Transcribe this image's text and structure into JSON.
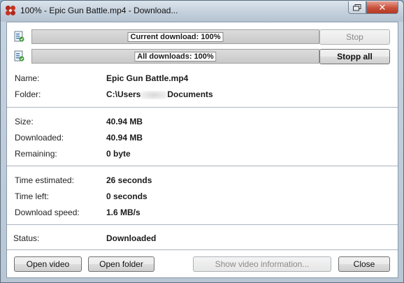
{
  "window": {
    "title": "100% - Epic Gun Battle.mp4 - Download...",
    "app_icon": "app-logo-icon",
    "restore_icon": "restore-window-icon",
    "close_icon": "close-icon"
  },
  "progress": {
    "current": {
      "label": "Current download: 100%",
      "value": 1.0
    },
    "all": {
      "label": "All downloads: 100%",
      "value": 1.0
    },
    "icon": "download-file-icon"
  },
  "buttons": {
    "stop": "Stop",
    "stop_all": "Stopp all",
    "open_video": "Open video",
    "open_folder": "Open folder",
    "show_info": "Show video information...",
    "close": "Close"
  },
  "file": {
    "name_label": "Name:",
    "name": "Epic Gun Battle.mp4",
    "folder_label": "Folder:",
    "folder_prefix": "C:\\Users",
    "folder_suffix": "Documents"
  },
  "sizes": {
    "size_label": "Size:",
    "size": "40.94 MB",
    "downloaded_label": "Downloaded:",
    "downloaded": "40.94 MB",
    "remaining_label": "Remaining:",
    "remaining": "0 byte"
  },
  "timing": {
    "estimated_label": "Time estimated:",
    "estimated": "26 seconds",
    "left_label": "Time left:",
    "left": "0 seconds",
    "speed_label": "Download speed:",
    "speed": "1.6 MB/s"
  },
  "status": {
    "label": "Status:",
    "value": "Downloaded"
  },
  "colors": {
    "close_button": "#c8503a",
    "separator": "#a9b4bf"
  }
}
